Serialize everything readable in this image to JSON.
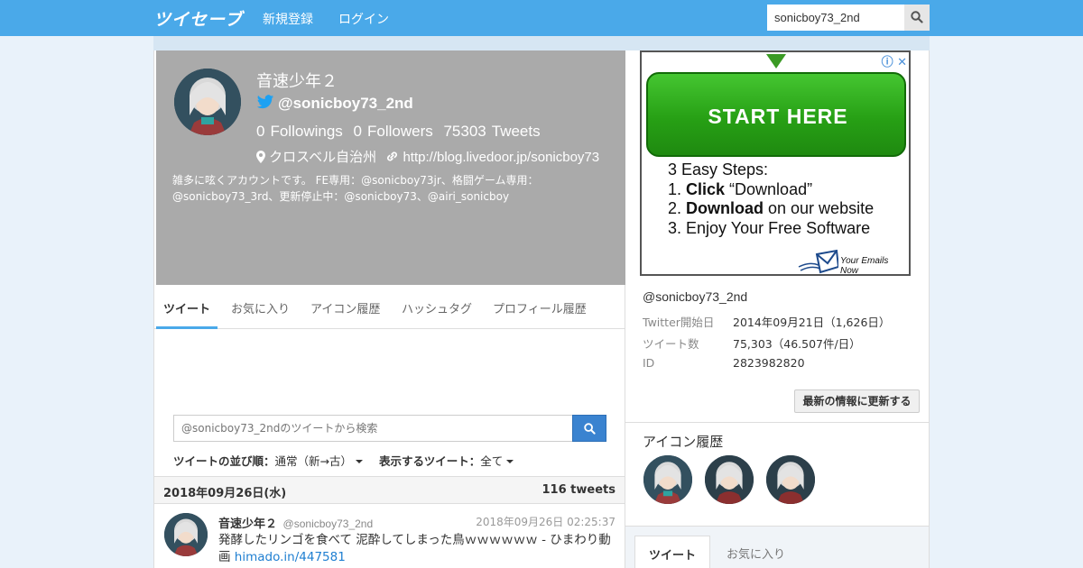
{
  "nav": {
    "logo": "ツイセーブ",
    "signup": "新規登録",
    "login": "ログイン",
    "search_value": "sonicboy73_2nd"
  },
  "profile": {
    "name": "音速少年２",
    "handle": "@sonicboy73_2nd",
    "followings_count": "0",
    "followings_label": "Followings",
    "followers_count": "0",
    "followers_label": "Followers",
    "tweets_count": "75303",
    "tweets_label": "Tweets",
    "location": "クロスベル自治州",
    "url": "http://blog.livedoor.jp/sonicboy73",
    "bio": "雑多に呟くアカウントです。 FE専用：@sonicboy73jr、格闘ゲーム専用：@sonicboy73_3rd、更新停止中：@sonicboy73、@airi_sonicboy"
  },
  "tabs": [
    "ツイート",
    "お気に入り",
    "アイコン履歴",
    "ハッシュタグ",
    "プロフィール履歴"
  ],
  "tweet_search": {
    "placeholder": "@sonicboy73_2ndのツイートから検索"
  },
  "sort": {
    "order_label": "ツイートの並び順：",
    "order_value": "通常（新→古）",
    "display_label": "表示するツイート：",
    "display_value": "全て"
  },
  "date_bar": {
    "date": "2018年09月26日(水)",
    "count": "116 tweets"
  },
  "tweet": {
    "name": "音速少年２",
    "handle": "@sonicboy73_2nd",
    "time": "2018年09月26日 02:25:37",
    "text": "発酵したリンゴを食べて 泥酔してしまった鳥ｗｗｗｗｗｗ - ひまわり動画 ",
    "link": "himado.in/447581"
  },
  "ad": {
    "info": "ⓘ ✕",
    "button": "START HERE",
    "heading": "3 Easy Steps:",
    "step1_num": "1. ",
    "step1_bold": "Click",
    "step1_rest": " “Download”",
    "step2_num": "2. ",
    "step2_bold": "Download",
    "step2_rest": " on our website",
    "step3": "3. Enjoy Your Free Software",
    "footer": "Your Emails Now"
  },
  "sidebar": {
    "handle": "@sonicboy73_2nd",
    "rows": [
      {
        "label": "Twitter開始日",
        "value": "2014年09月21日（1,626日）"
      },
      {
        "label": "ツイート数",
        "value": "75,303（46.507件/日）"
      },
      {
        "label": "ID",
        "value": "2823982820"
      }
    ],
    "refresh": "最新の情報に更新する",
    "icon_history_title": "アイコン履歴",
    "tabs": [
      "ツイート",
      "お気に入り"
    ]
  }
}
